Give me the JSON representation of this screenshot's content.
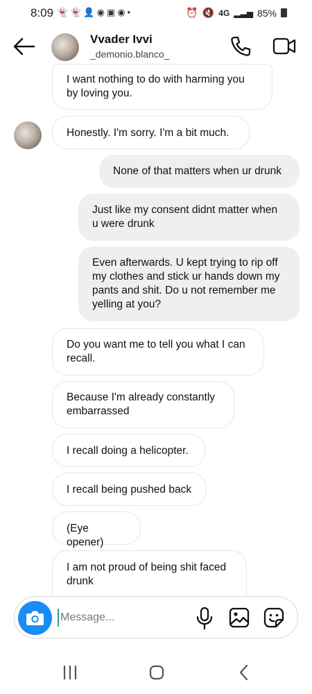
{
  "status_bar": {
    "time": "8:09",
    "network": "4G",
    "battery": "85%",
    "left_icons": [
      "snapchat-icon",
      "snapchat-icon",
      "user-icon",
      "messenger-icon",
      "instagram-icon",
      "messenger-icon",
      "dot-icon"
    ]
  },
  "header": {
    "name": "Vvader Ivvi",
    "username": "_demonio.blanco_"
  },
  "messages": [
    {
      "side": "incoming",
      "text": "I want nothing to do with harming you by loving you."
    },
    {
      "side": "incoming",
      "text": "Honestly.  I'm sorry. I'm a bit much."
    },
    {
      "side": "outgoing",
      "text": "None of that matters when ur drunk"
    },
    {
      "side": "outgoing",
      "text": "Just like my consent didnt matter when u were drunk"
    },
    {
      "side": "outgoing",
      "text": "Even afterwards. U kept trying to rip off my clothes and stick ur hands down my pants and shit. Do u not remember me yelling at you?"
    },
    {
      "side": "incoming",
      "text": "Do you want me to tell you what I can recall."
    },
    {
      "side": "incoming",
      "text": "Because I'm already constantly embarrassed"
    },
    {
      "side": "incoming",
      "text": "I recall doing a helicopter."
    },
    {
      "side": "incoming",
      "text": "I recall being pushed back"
    },
    {
      "side": "incoming",
      "text": "(Eye opener)"
    },
    {
      "side": "incoming",
      "text": "I am not proud of being shit faced drunk"
    }
  ],
  "composer": {
    "placeholder": "Message...",
    "value": ""
  },
  "colors": {
    "camera_button": "#1a8cf3",
    "outgoing_bubble": "#efefef",
    "incoming_border": "#e6e6e6"
  }
}
